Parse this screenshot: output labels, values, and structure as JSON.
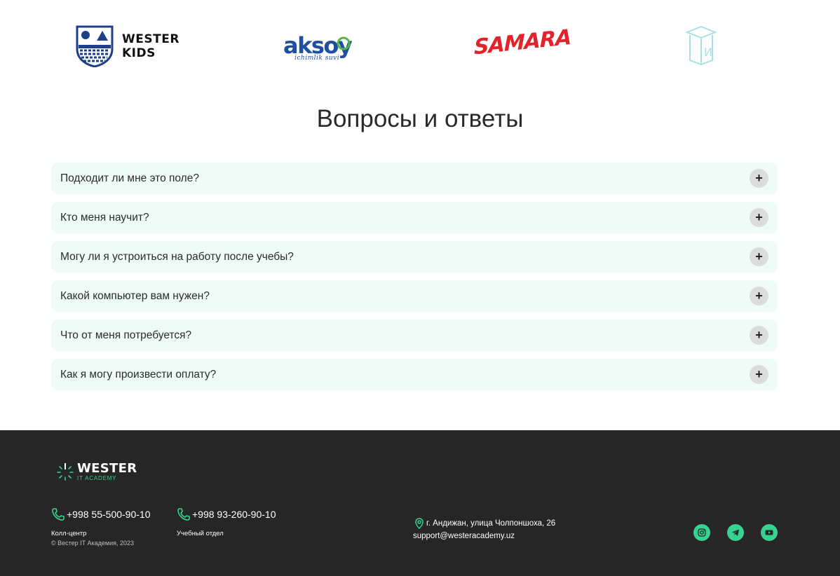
{
  "partners": {
    "wester_kids": {
      "line1": "WESTER",
      "line2": "KIDS"
    },
    "aksoy": {
      "word": "aksoy",
      "sub": "ichimlik suvi"
    },
    "samara": {
      "word": "SAMARA"
    },
    "book": {
      "letter": "И"
    }
  },
  "faq": {
    "title": "Вопросы и ответы",
    "toggle_symbol": "+",
    "items": [
      {
        "question": "Подходит ли мне это поле?"
      },
      {
        "question": "Кто меня научит?"
      },
      {
        "question": "Могу ли я устроиться на работу после учебы?"
      },
      {
        "question": "Какой компьютер вам нужен?"
      },
      {
        "question": "Что от меня потребуется?"
      },
      {
        "question": "Как я могу произвести оплату?"
      }
    ]
  },
  "footer": {
    "logo": {
      "main": "WESTER",
      "sub": "IT ACADEMY"
    },
    "phone1": {
      "number": "+998 55-500-90-10",
      "label": "Колл-центр"
    },
    "phone2": {
      "number": "+998 93-260-90-10",
      "label": "Учебный отдел"
    },
    "copyright": "© Вестер IT Академия, 2023",
    "address": "г. Андижан, улица Чолпоншоха, 26",
    "email": "support@westeracademy.uz",
    "social": [
      "instagram-icon",
      "telegram-icon",
      "youtube-icon"
    ]
  },
  "colors": {
    "accent": "#36d38e",
    "faq_bg": "#eefbf7",
    "footer_bg": "#262626",
    "brand_blue": "#1f4fa0",
    "brand_red": "#e2232a"
  }
}
